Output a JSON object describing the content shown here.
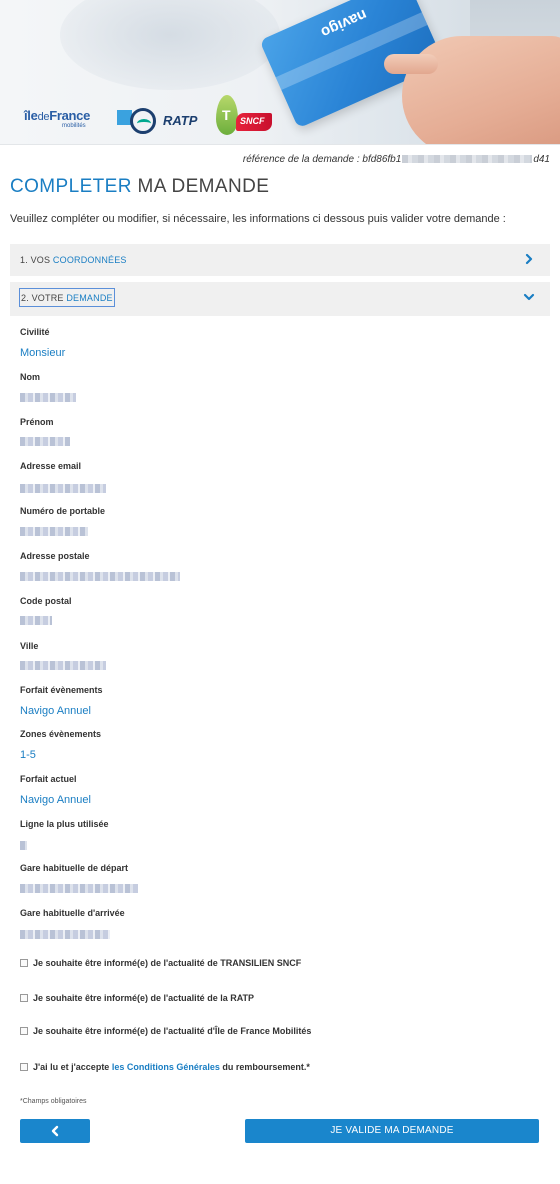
{
  "header": {
    "logos": {
      "idf_word_ile": "île",
      "idf_word_de": "de",
      "idf_word_france": "France",
      "idf_sub": "mobilités",
      "ratp": "RATP",
      "sncf_t": "T",
      "sncf": "SNCF"
    },
    "card_text": "navigo"
  },
  "reference": {
    "prefix": "référence de la demande : bfd86fb1",
    "suffix": "d41"
  },
  "page": {
    "title_highlight": "COMPLETER",
    "title_rest": " MA DEMANDE",
    "intro": "Veuillez compléter ou modifier, si nécessaire, les informations ci dessous puis valider votre demande :"
  },
  "sections": [
    {
      "prefix": "1. VOS ",
      "highlight": "COORDONNÉES",
      "icon": "chevron-right-icon"
    },
    {
      "prefix": "2. VOTRE ",
      "highlight": "DEMANDE",
      "icon": "chevron-down-icon"
    }
  ],
  "fields": {
    "civilite": {
      "label": "Civilité",
      "value": "Monsieur"
    },
    "nom": {
      "label": "Nom"
    },
    "prenom": {
      "label": "Prénom"
    },
    "email": {
      "label": "Adresse email"
    },
    "portable": {
      "label": "Numéro de portable"
    },
    "adresse": {
      "label": "Adresse postale"
    },
    "code_postal": {
      "label": "Code postal"
    },
    "ville": {
      "label": "Ville"
    },
    "forfait_evenements": {
      "label": "Forfait évènements",
      "value": "Navigo Annuel"
    },
    "zones_evenements": {
      "label": "Zones évènements",
      "value": "1-5"
    },
    "forfait_actuel": {
      "label": "Forfait actuel",
      "value": "Navigo Annuel"
    },
    "ligne": {
      "label": "Ligne la plus utilisée"
    },
    "gare_depart": {
      "label": "Gare habituelle de départ"
    },
    "gare_arrivee": {
      "label": "Gare habituelle d'arrivée"
    }
  },
  "checkboxes": [
    {
      "text": "Je souhaite être informé(e) de l'actualité de TRANSILIEN SNCF",
      "checked": false
    },
    {
      "text": "Je souhaite être informé(e) de l'actualité de la RATP",
      "checked": false
    },
    {
      "text": "Je souhaite être informé(e) de l'actualité d'Île de France Mobilités",
      "checked": false
    }
  ],
  "terms": {
    "before": "J'ai lu et j'accepte ",
    "link": "les Conditions Générales",
    "after": " du remboursement.*",
    "checked": false
  },
  "required_note": "*Champs obligatoires",
  "buttons": {
    "back_icon": "‹",
    "submit": "JE VALIDE MA DEMANDE"
  },
  "colors": {
    "accent": "#1a7ec3",
    "button": "#1a86cc",
    "section_bg": "#f0f0f0"
  }
}
